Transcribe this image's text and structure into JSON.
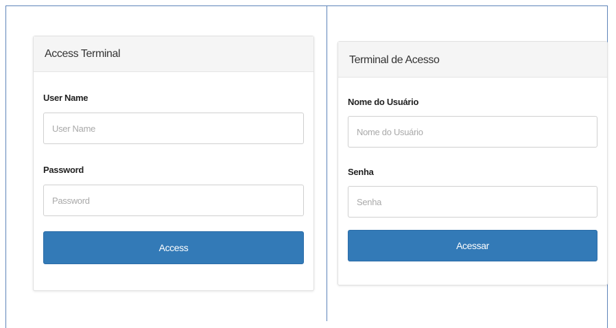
{
  "panels": {
    "english": {
      "heading": "Access Terminal",
      "username_label": "User Name",
      "username_placeholder": "User Name",
      "password_label": "Password",
      "password_placeholder": "Password",
      "submit_label": "Access"
    },
    "portuguese": {
      "heading": "Terminal de Acesso",
      "username_label": "Nome do Usuário",
      "username_placeholder": "Nome do Usuário",
      "password_label": "Senha",
      "password_placeholder": "Senha",
      "submit_label": "Acessar"
    }
  },
  "colors": {
    "primary_button": "#337ab7",
    "panel_heading_bg": "#f5f5f5",
    "frame_border": "#5b82b8"
  }
}
